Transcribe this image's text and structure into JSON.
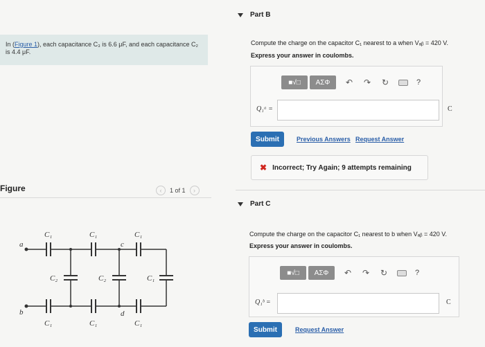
{
  "intro": {
    "prefix": "In (",
    "link": "Figure 1",
    "suffix": "), each capacitance C₃ is 6.6 μF, and each capacitance C₂ is 4.4 μF."
  },
  "figure": {
    "label": "Figure",
    "pager": "1 of 1",
    "prev": "‹",
    "next": "›",
    "labels": {
      "a": "a",
      "b": "b",
      "c": "c",
      "d": "d",
      "c1": "C₁",
      "c2": "C₂"
    }
  },
  "toolbar": {
    "sqrt_btn": "■√□",
    "greek_btn": "AΣΦ",
    "undo": "↶",
    "redo": "↷",
    "reset": "↻",
    "help": "?"
  },
  "partB": {
    "title": "Part B",
    "prompt": "Compute the charge on the capacitor C₁ nearest to a when Vₐᵦ = 420 V.",
    "sub": "Express your answer in coulombs.",
    "var_label": "Q₁ᵃ =",
    "input_value": "",
    "unit": "C",
    "submit": "Submit",
    "prev_answers": "Previous Answers",
    "request_answer": "Request Answer",
    "feedback": "Incorrect; Try Again; 9 attempts remaining",
    "feedback_icon": "✖"
  },
  "partC": {
    "title": "Part C",
    "prompt": "Compute the charge on the capacitor C₁ nearest to b when Vₐᵦ = 420 V.",
    "sub": "Express your answer in coulombs.",
    "var_label": "Q₁ᵇ =",
    "input_value": "",
    "unit": "C",
    "submit": "Submit",
    "request_answer": "Request Answer"
  }
}
